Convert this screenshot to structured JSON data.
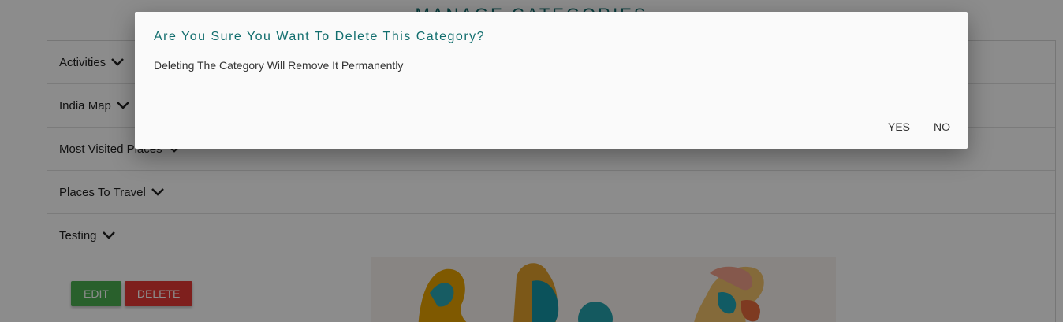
{
  "page": {
    "title": "Manage Categories"
  },
  "categories": [
    {
      "label": "Activities"
    },
    {
      "label": "India Map"
    },
    {
      "label": "Most Visited Places"
    },
    {
      "label": "Places To Travel"
    },
    {
      "label": "Testing"
    }
  ],
  "icons": {
    "expand": "chevron-down-icon"
  },
  "actions": {
    "edit_label": "EDIT",
    "delete_label": "DELETE"
  },
  "dialog": {
    "title": "Are You Sure You Want To Delete This Category?",
    "message": "Deleting The Category Will Remove It Permanently",
    "yes_label": "YES",
    "no_label": "NO"
  },
  "colors": {
    "title": "#126e6e",
    "edit": "#4caf50",
    "delete": "#e53935",
    "overlay": "rgba(0,0,0,0.45)"
  }
}
